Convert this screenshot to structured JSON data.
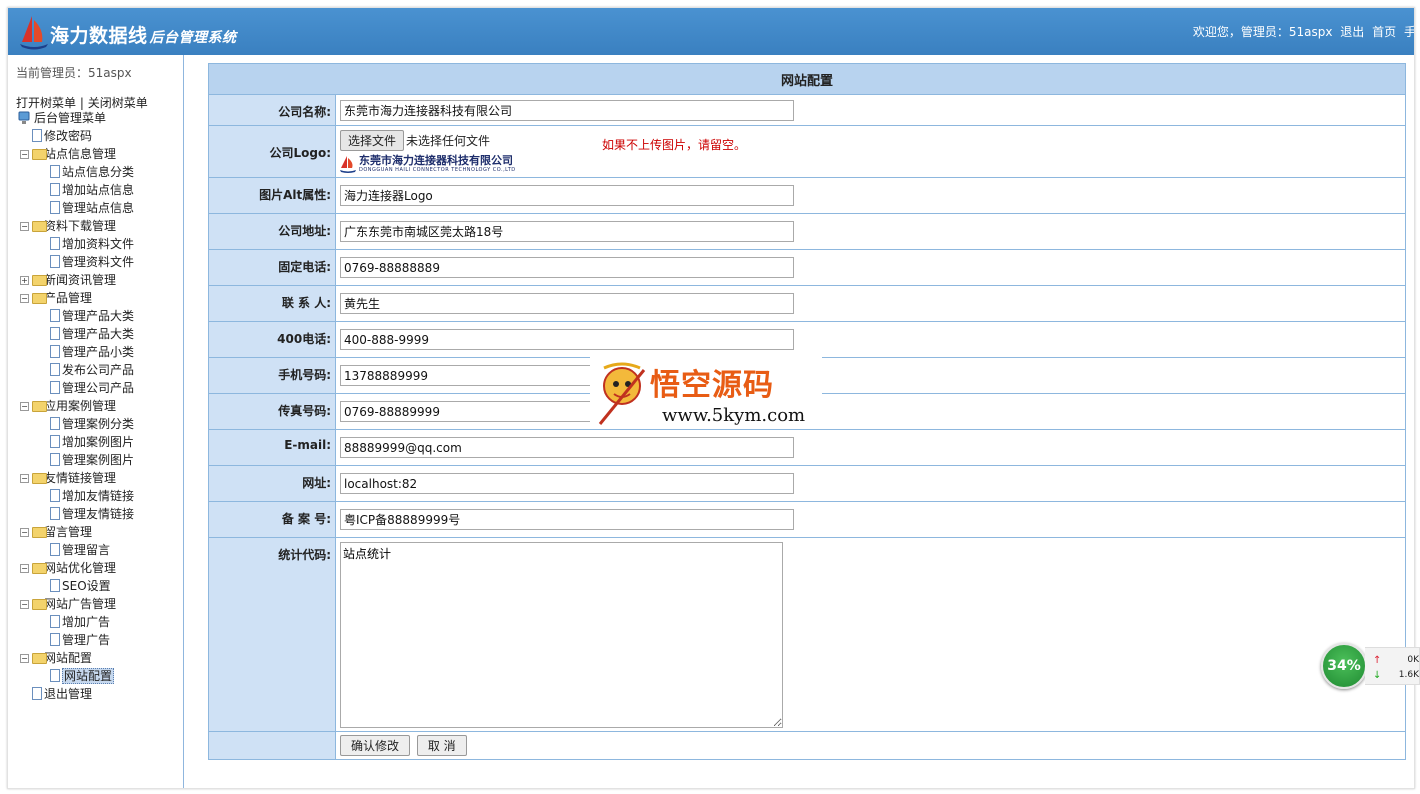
{
  "header": {
    "brand_name": "海力数据线",
    "brand_sub": "后台管理系统",
    "welcome": "欢迎您，管理员：51aspx",
    "logout": "退出",
    "home": "首页",
    "cut": "手"
  },
  "sidebar": {
    "current_admin": "当前管理员：51aspx",
    "open_tree": "打开树菜单",
    "separator": "|",
    "close_tree": "关闭树菜单",
    "root": "后台管理菜单",
    "change_password": "修改密码",
    "groups": [
      {
        "label": "站点信息管理",
        "items": [
          "站点信息分类",
          "增加站点信息",
          "管理站点信息"
        ]
      },
      {
        "label": "资料下载管理",
        "items": [
          "增加资料文件",
          "管理资料文件"
        ]
      },
      {
        "label": "新闻资讯管理",
        "items": []
      },
      {
        "label": "产品管理",
        "items": [
          "管理产品大类",
          "管理产品大类",
          "管理产品小类",
          "发布公司产品",
          "管理公司产品"
        ]
      },
      {
        "label": "应用案例管理",
        "items": [
          "管理案例分类",
          "增加案例图片",
          "管理案例图片"
        ]
      },
      {
        "label": "友情链接管理",
        "items": [
          "增加友情链接",
          "管理友情链接"
        ]
      },
      {
        "label": "留言管理",
        "items": [
          "管理留言"
        ]
      },
      {
        "label": "网站优化管理",
        "items": [
          "SEO设置"
        ]
      },
      {
        "label": "网站广告管理",
        "items": [
          "增加广告",
          "管理广告"
        ]
      },
      {
        "label": "网站配置",
        "items": [
          "网站配置"
        ]
      }
    ],
    "logout": "退出管理"
  },
  "form": {
    "title": "网站配置",
    "fields": {
      "company_name": {
        "label": "公司名称:",
        "value": "东莞市海力连接器科技有限公司"
      },
      "company_logo": {
        "label": "公司Logo:",
        "file_button": "选择文件",
        "no_file": "未选择任何文件",
        "hint": "如果不上传图片，请留空。",
        "logo_cn": "东莞市海力连接器科技有限公司",
        "logo_en": "DONGGUAN HAILI CONNECTOR TECHNOLOGY CO.,LTD"
      },
      "alt": {
        "label": "图片Alt属性:",
        "value": "海力连接器Logo"
      },
      "address": {
        "label": "公司地址:",
        "value": "广东东莞市南城区莞太路18号"
      },
      "phone": {
        "label": "固定电话:",
        "value": "0769-88888889"
      },
      "contact": {
        "label": "联 系 人:",
        "value": "黄先生"
      },
      "hotline": {
        "label": "400电话:",
        "value": "400-888-9999"
      },
      "mobile": {
        "label": "手机号码:",
        "value": "13788889999"
      },
      "fax": {
        "label": "传真号码:",
        "value": "0769-88889999"
      },
      "email": {
        "label": "E-mail:",
        "value": "88889999@qq.com"
      },
      "url": {
        "label": "网址:",
        "value": "localhost:82"
      },
      "icp": {
        "label": "备 案 号:",
        "value": "粤ICP备88889999号"
      },
      "stats": {
        "label": "统计代码:",
        "value": "站点统计"
      }
    },
    "confirm": "确认修改",
    "cancel": "取 消"
  },
  "watermark": {
    "title": "悟空源码",
    "url": "www.5kym.com"
  },
  "speed_widget": {
    "percent": "34%",
    "up_value": "0K",
    "down_value": "1.6K"
  },
  "colors": {
    "header_blue": "#3f87c7",
    "label_bg": "#cfe1f5",
    "title_bg": "#b8d3ef",
    "hint_red": "#cc0000"
  }
}
